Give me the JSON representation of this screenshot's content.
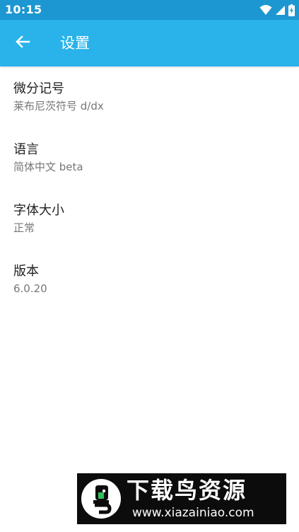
{
  "status_bar": {
    "time": "10:15",
    "icons": [
      "wifi-icon",
      "cellular-signal-icon",
      "battery-charging-icon"
    ]
  },
  "app_bar": {
    "back_icon": "arrow-left-icon",
    "title": "设置"
  },
  "settings": [
    {
      "title": "微分记号",
      "value": "莱布尼茨符号 d/dx"
    },
    {
      "title": "语言",
      "value": "简体中文 beta"
    },
    {
      "title": "字体大小",
      "value": "正常"
    },
    {
      "title": "版本",
      "value": "6.0.20"
    }
  ],
  "watermark": {
    "title": "下载鸟资源",
    "url": "www.xiazainiao.com"
  },
  "colors": {
    "status_bar": "#1d97d1",
    "app_bar": "#29b3ea",
    "title_text": "#222222",
    "value_text": "#777777"
  }
}
